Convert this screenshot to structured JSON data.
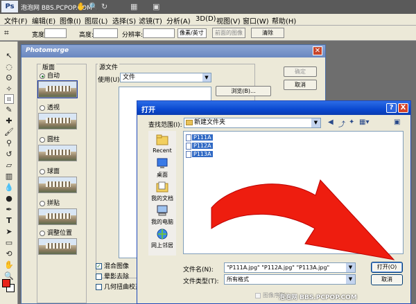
{
  "appbar": {
    "logo": "Ps",
    "watermark": "泡泡网 BBS.PCPOP.COM"
  },
  "menu": [
    "文件(F)",
    "编辑(E)",
    "图像(I)",
    "图层(L)",
    "选择(S)",
    "滤镜(T)",
    "分析(A)",
    "3D(D)",
    "视图(V)",
    "窗口(W)",
    "帮助(H)"
  ],
  "options": {
    "width_label": "宽度:",
    "height_label": "高度:",
    "resolution_label": "分辨率:",
    "unit_value": "像素/英寸",
    "front_image_button": "前面的图像",
    "clear_button": "清除"
  },
  "photomerge": {
    "title": "Photomerge",
    "layout_legend": "版面",
    "layouts": [
      "自动",
      "透视",
      "圆柱",
      "球面",
      "拼贴",
      "调整位置"
    ],
    "selected_layout": "自动",
    "source_legend": "源文件",
    "use_label": "使用(U):",
    "use_value": "文件",
    "ok_button": "确定",
    "cancel_button": "取消",
    "browse_button": "浏览(B)...",
    "checkboxes": [
      {
        "label": "混合图像",
        "checked": true
      },
      {
        "label": "晕影去除",
        "checked": false
      },
      {
        "label": "几何扭曲校正",
        "checked": false
      }
    ]
  },
  "open_dialog": {
    "title": "打开",
    "look_in_label": "查找范围(I):",
    "look_in_value": "新建文件夹",
    "places": [
      "Recent",
      "桌面",
      "我的文档",
      "我的电脑",
      "网上邻居"
    ],
    "files": [
      "P111A",
      "P112A",
      "P113A"
    ],
    "file_name_label": "文件名(N):",
    "file_name_value": "\"P111A.jpg\" \"P112A.jpg\" \"P113A.jpg\"",
    "file_type_label": "文件类型(T):",
    "file_type_value": "所有格式",
    "image_sequence_label": "图像序列",
    "open_button": "打开(O)",
    "cancel_button": "取消",
    "help_button": "?",
    "close_button": "X"
  },
  "footer": "泡泡网 BBS.PCPOP.COM",
  "colors": {
    "foreground": "#e8231a",
    "background": "#ffffff",
    "arrow": "#ee1d0f"
  }
}
